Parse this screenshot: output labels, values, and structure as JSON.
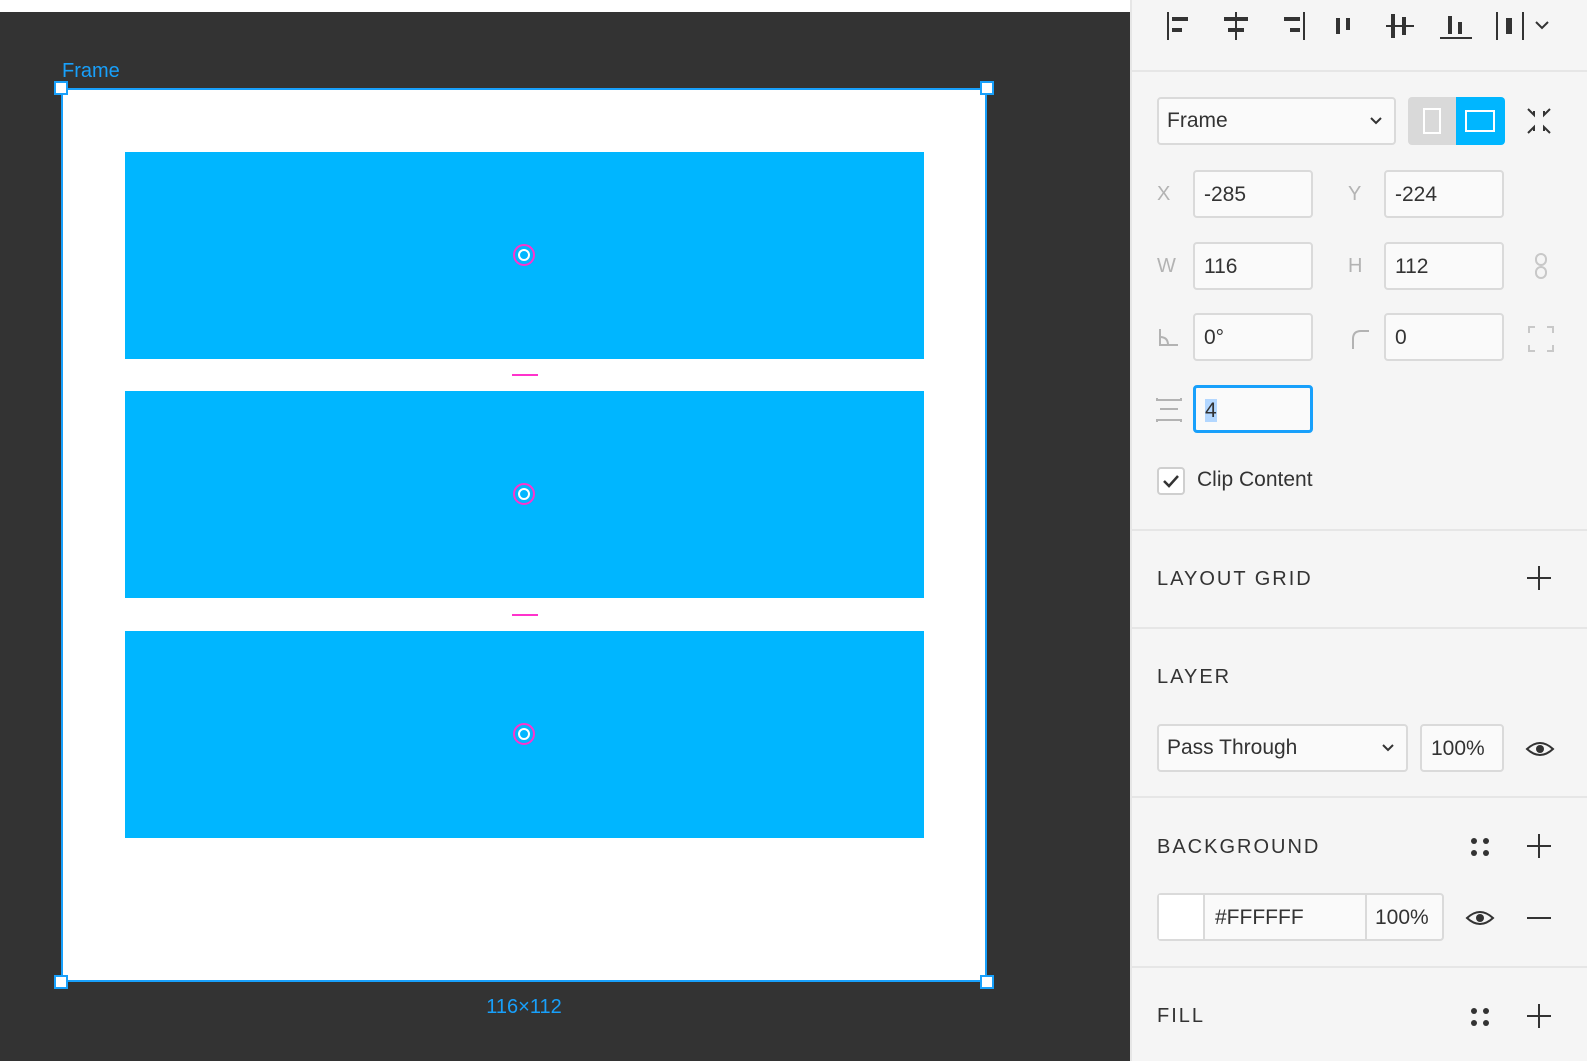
{
  "canvas": {
    "frame_label": "Frame",
    "size_label": "116×112"
  },
  "panel": {
    "align_icons": [
      "align-left-icon",
      "align-horizontal-center-icon",
      "align-right-icon",
      "align-top-icon",
      "align-vertical-center-icon",
      "align-bottom-icon",
      "distribute-icon",
      "more-chevron-icon"
    ],
    "frame_select": "Frame",
    "orientation": {
      "portrait": "portrait-icon",
      "landscape": "landscape-icon",
      "active": "landscape"
    },
    "x_label": "X",
    "x_value": "-285",
    "y_label": "Y",
    "y_value": "-224",
    "w_label": "W",
    "w_value": "116",
    "h_label": "H",
    "h_value": "112",
    "rotation_value": "0°",
    "radius_value": "0",
    "spacing_value": "4",
    "clip_content": {
      "label": "Clip Content",
      "checked": true
    },
    "layout_grid": {
      "title": "LAYOUT GRID"
    },
    "layer": {
      "title": "LAYER",
      "blend_mode": "Pass Through",
      "opacity": "100%"
    },
    "background": {
      "title": "BACKGROUND",
      "hex": "#FFFFFF",
      "opacity": "100%"
    },
    "fill": {
      "title": "FILL"
    }
  },
  "colors": {
    "accent": "#18a0fb",
    "rect": "#00b6ff",
    "spacing_marker": "#ff33cc",
    "canvas_bg": "#333333"
  }
}
